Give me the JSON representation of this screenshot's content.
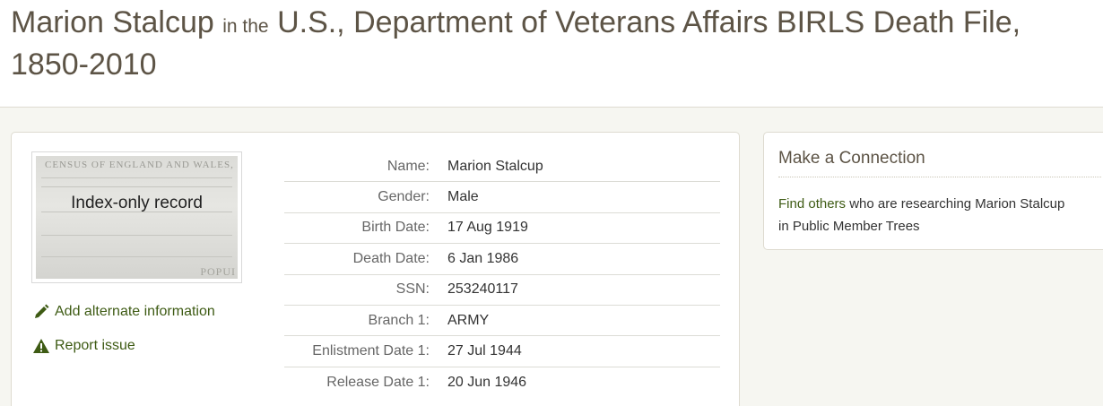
{
  "header": {
    "name": "Marion Stalcup",
    "connector": "in the",
    "collection": "U.S., Department of Veterans Affairs BIRLS Death File, 1850-2010"
  },
  "thumbnail": {
    "label": "Index-only record",
    "bg_top_text": "CENSUS OF ENGLAND AND WALES,",
    "bg_bottom_text": "POPUI"
  },
  "actions": {
    "add_alternate": "Add alternate information",
    "report_issue": "Report issue"
  },
  "facts": [
    {
      "label": "Name:",
      "value": "Marion Stalcup"
    },
    {
      "label": "Gender:",
      "value": "Male"
    },
    {
      "label": "Birth Date:",
      "value": "17 Aug 1919"
    },
    {
      "label": "Death Date:",
      "value": "6 Jan 1986"
    },
    {
      "label": "SSN:",
      "value": "253240117"
    },
    {
      "label": "Branch 1:",
      "value": "ARMY"
    },
    {
      "label": "Enlistment Date 1:",
      "value": "27 Jul 1944"
    },
    {
      "label": "Release Date 1:",
      "value": "20 Jun 1946"
    }
  ],
  "connection": {
    "title": "Make a Connection",
    "link_text": "Find others",
    "rest_text": " who are researching Marion Stalcup in Public Member Trees"
  },
  "colors": {
    "title": "#5d5446",
    "link_green": "#3e5b14",
    "page_bg": "#f6f6f1",
    "warning_icon": "#3e5b14"
  }
}
